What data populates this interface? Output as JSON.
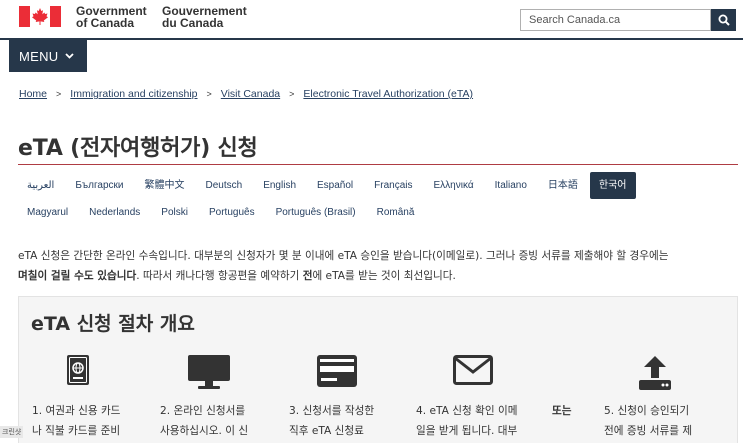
{
  "header": {
    "signature_en": [
      "Government",
      "of Canada"
    ],
    "signature_fr": [
      "Gouvernement",
      "du Canada"
    ],
    "search_placeholder": "Search Canada.ca",
    "search_button_icon": "search-icon"
  },
  "menu": {
    "label": "MENU",
    "icon": "chevron-down-icon"
  },
  "breadcrumb": [
    "Home",
    "Immigration and citizenship",
    "Visit Canada",
    "Electronic Travel Authorization (eTA)"
  ],
  "page_title": "eTA (전자여행허가) 신청",
  "languages": {
    "row1": [
      "العربية",
      "Български",
      "繁體中文",
      "Deutsch",
      "English",
      "Español",
      "Français",
      "Ελληνικά",
      "Italiano",
      "日本語",
      "한국어"
    ],
    "row2": [
      "Magyarul",
      "Nederlands",
      "Polski",
      "Português",
      "Português (Brasil)",
      "Română"
    ],
    "active": "한국어"
  },
  "intro": {
    "line1": "eTA 신청은 간단한 온라인 수속입니다. 대부분의 신청자가 몇 분 이내에 eTA 승인을 받습니다(이메일로). 그러나 증빙 서류를 제출해야 할 경우에는",
    "line2_bold1": "며칠이 걸릴 수도 있습니다",
    "line2_mid": ". 따라서 캐나다행 항공편을 예약하기 ",
    "line2_bold2": "전",
    "line2_end": "에 eTA를 받는 것이 최선입니다."
  },
  "overview": {
    "title": "eTA 신청 절차 개요",
    "steps": [
      {
        "icon": "passport-icon",
        "text": "1. 여권과 신용 카드\n나 직불 카드를 준비"
      },
      {
        "icon": "computer-monitor-icon",
        "text": "2. 온라인 신청서를\n사용하십시오. 이 신"
      },
      {
        "icon": "credit-card-icon",
        "text": "3. 신청서를 작성한\n직후 eTA 신청료"
      },
      {
        "icon": "envelope-icon",
        "text": "4. eTA 신청 확인 이메\n일을 받게 됩니다. 대부"
      },
      {
        "icon": "",
        "text": "또는"
      },
      {
        "icon": "upload-icon",
        "text": "5. 신청이 승인되기\n전에 증빙 서류를 제"
      }
    ]
  },
  "side_label": "크린샷",
  "colors": {
    "navy": "#26374a",
    "flag_red": "#eb2d37",
    "title_rule": "#af3c43",
    "link": "#284162"
  }
}
